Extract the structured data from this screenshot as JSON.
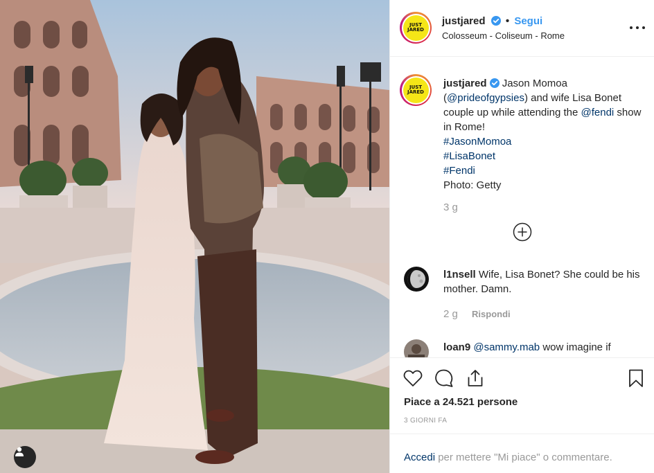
{
  "post": {
    "username": "justjared",
    "follow_label": "Segui",
    "dot": "•",
    "location": "Colosseum - Coliseum - Rome",
    "avatar_text_1": "JUST",
    "avatar_text_2": "JARED"
  },
  "caption": {
    "username": "justjared",
    "text_1": " Jason Momoa (",
    "mention_1": "@prideofgypsies",
    "text_2": ") and wife Lisa Bonet couple up while attending the ",
    "mention_2": "@fendi",
    "text_3": " show in Rome!",
    "hashtag_1": "#JasonMomoa",
    "hashtag_2": "#LisaBonet",
    "hashtag_3": "#Fendi",
    "photo_credit": "Photo: Getty",
    "time": "3 g"
  },
  "comments": [
    {
      "username": "l1nsell",
      "text": " Wife, Lisa Bonet? She could be his mother. Damn.",
      "time": "2 g",
      "reply": "Rispondi"
    },
    {
      "username": "loan9",
      "mention": "@sammy.mab",
      "text": " wow imagine if"
    }
  ],
  "actions": {
    "likes": "Piace a 24.521 persone",
    "ago": "3 GIORNI FA"
  },
  "login": {
    "link": "Accedi",
    "text": " per mettere \"Mi piace\" o commentare."
  },
  "icons": {
    "more": "more-options-icon",
    "heart": "heart-icon",
    "comment": "comment-icon",
    "share": "share-icon",
    "save": "bookmark-icon",
    "load_more": "plus-circle-icon",
    "user_tag": "user-tag-icon",
    "verified": "verified-badge-icon"
  },
  "colors": {
    "link": "#003569",
    "follow": "#3897f0",
    "verified": "#3897f0",
    "muted": "#999999",
    "avatar_yellow": "#f5e617"
  }
}
